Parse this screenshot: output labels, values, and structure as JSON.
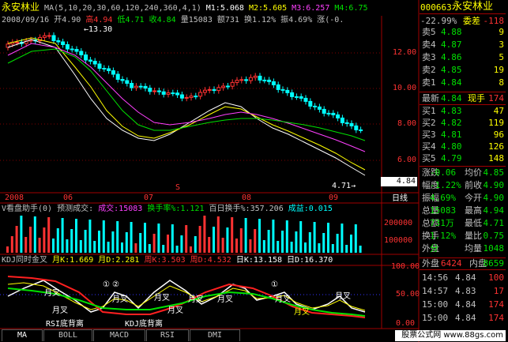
{
  "header": {
    "stock_name": "永安林业",
    "ma_label": "MA(5,10,20,30,60,120,240,360,4,1)",
    "m1": "M1:5.068",
    "m2": "M2:5.605",
    "m3": "M3:6.257",
    "m4": "M4:6.75"
  },
  "info_line": {
    "date": "2008/09/16",
    "open": "开4.90",
    "high": "高4.94",
    "low": "低4.71",
    "close": "收4.84",
    "volume": "量15083",
    "amount": "额731",
    "turnover": "换1.12%",
    "amplitude": "振4.69%",
    "change": "涨(-0."
  },
  "price_chart": {
    "y_ticks": [
      "12.00",
      "10.00",
      "8.00",
      "6.00"
    ],
    "x_ticks": [
      "2008",
      "06",
      "07",
      "08",
      "09"
    ],
    "annotation_high": "13.30",
    "annotation_low": "4.71",
    "current_price_tag": "4.84",
    "period_label": "日线",
    "marker": "S"
  },
  "volume_panel": {
    "title": "V看盘助手(0)",
    "predict": "预测成交:",
    "cjl": "成交:15083",
    "turnover_rate": "换手率%:1.121",
    "hundred_day": "百日换手%:357.206",
    "label_more": "成益:0.015",
    "y_ticks": [
      "200000",
      "100000"
    ],
    "unit": "%"
  },
  "kdj_panel": {
    "title": "KDJ同时金叉",
    "yk": "月K:1.669",
    "yd": "月D:2.281",
    "zk": "周K:3.503",
    "zd": "周D:4.532",
    "rk": "日K:13.158",
    "rd": "日D:16.370",
    "y_ticks": [
      "100.00",
      "50.00",
      "0.00"
    ],
    "cross_label": "月叉",
    "circle_1": "①",
    "circle_2": "②",
    "rsi_low": "RSI底背离",
    "kdj_low": "KDJ底背离"
  },
  "tabs": [
    "MA",
    "BOLL",
    "MACD",
    "RSI",
    "DMI"
  ],
  "watermark": "股票公式网 www.88gs.com",
  "side_panel": {
    "code": "000663",
    "name": "永安林业",
    "weibi": "-22.99%",
    "weicha": "委差",
    "weicha_val": "-118",
    "sells": [
      {
        "label": "卖5",
        "price": "4.88",
        "vol": "9"
      },
      {
        "label": "卖4",
        "price": "4.87",
        "vol": "3"
      },
      {
        "label": "卖3",
        "price": "4.86",
        "vol": "5"
      },
      {
        "label": "卖2",
        "price": "4.85",
        "vol": "19"
      },
      {
        "label": "卖1",
        "price": "4.84",
        "vol": "8"
      }
    ],
    "latest_label": "最新",
    "latest_price": "4.84",
    "xianshou": "现手",
    "xianshou_val": "174",
    "buys": [
      {
        "label": "买1",
        "price": "4.83",
        "vol": "47"
      },
      {
        "label": "买2",
        "price": "4.82",
        "vol": "119"
      },
      {
        "label": "买3",
        "price": "4.81",
        "vol": "96"
      },
      {
        "label": "买4",
        "price": "4.80",
        "vol": "126"
      },
      {
        "label": "买5",
        "price": "4.79",
        "vol": "148"
      }
    ],
    "stats": [
      {
        "l": "涨跌",
        "v": "-0.06",
        "l2": "均价",
        "v2": "4.85"
      },
      {
        "l": "幅度",
        "v": "-1.22%",
        "l2": "前收",
        "v2": "4.90"
      },
      {
        "l": "振幅",
        "v": "4.69%",
        "l2": "今开",
        "v2": "4.90"
      },
      {
        "l": "总量",
        "v": "15083",
        "l2": "最高",
        "v2": "4.94"
      },
      {
        "l": "总额",
        "v": "731万",
        "l2": "最低",
        "v2": "4.71"
      },
      {
        "l": "换手",
        "v": "1.12%",
        "l2": "量比",
        "v2": "0.75"
      },
      {
        "l": "外盘",
        "v": "分",
        "l2": "均量",
        "v2": "1048"
      }
    ],
    "waipan": "外盘",
    "waipan_val": "6424",
    "neipan": "内盘",
    "neipan_val": "8659",
    "ticks": [
      {
        "time": "14:56",
        "price": "4.84",
        "vol": "100"
      },
      {
        "time": "14:57",
        "price": "4.83",
        "vol": "17"
      },
      {
        "time": "15:00",
        "price": "4.84",
        "vol": "174"
      },
      {
        "time": "15:00",
        "price": "4.84",
        "vol": "174"
      }
    ]
  },
  "colors": {
    "up": "#ff3232",
    "down": "#00ffff",
    "background": "#000000",
    "grid": "#800000"
  }
}
